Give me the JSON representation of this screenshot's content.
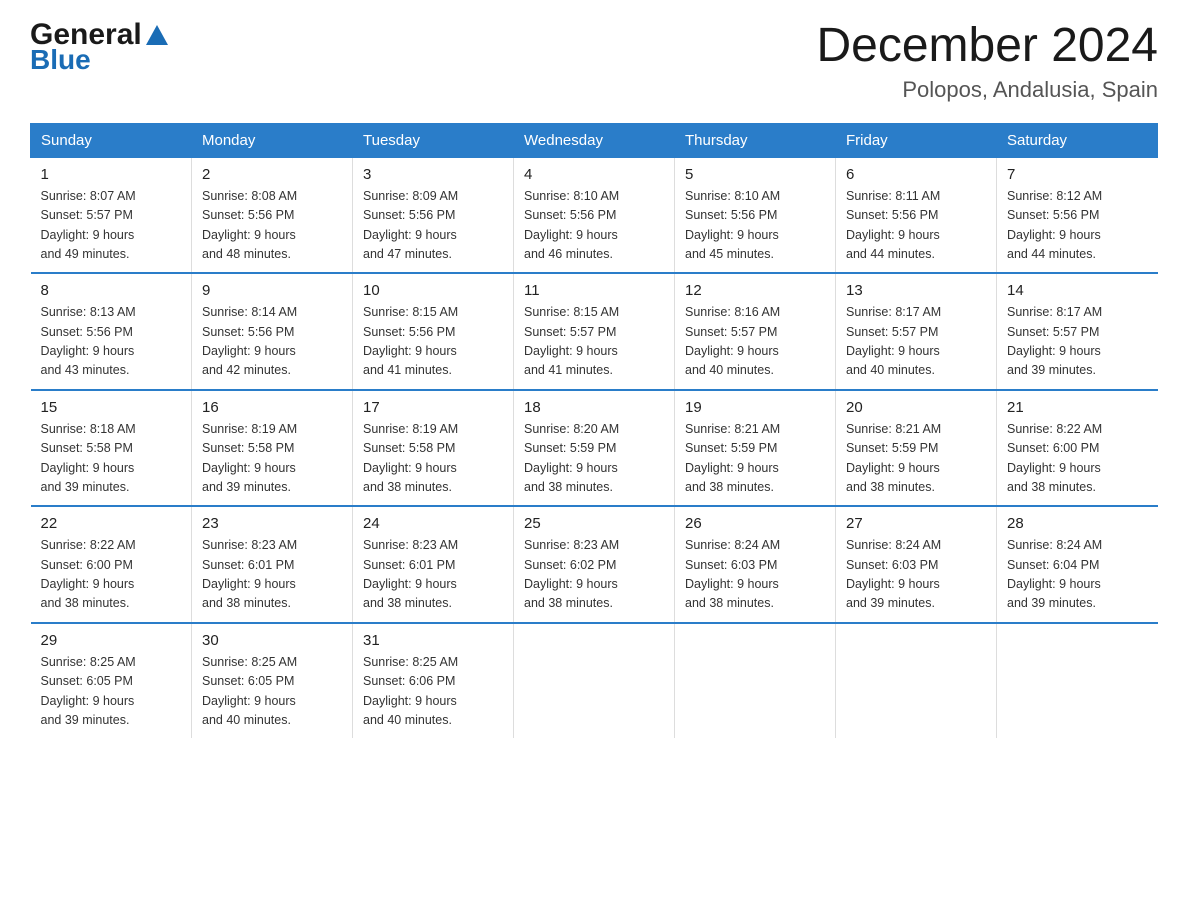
{
  "logo": {
    "text_general": "General",
    "triangle_symbol": "▲",
    "text_blue": "Blue"
  },
  "header": {
    "title": "December 2024",
    "subtitle": "Polopos, Andalusia, Spain"
  },
  "days_of_week": [
    "Sunday",
    "Monday",
    "Tuesday",
    "Wednesday",
    "Thursday",
    "Friday",
    "Saturday"
  ],
  "weeks": [
    [
      {
        "day": "1",
        "sunrise": "8:07 AM",
        "sunset": "5:57 PM",
        "daylight": "9 hours and 49 minutes."
      },
      {
        "day": "2",
        "sunrise": "8:08 AM",
        "sunset": "5:56 PM",
        "daylight": "9 hours and 48 minutes."
      },
      {
        "day": "3",
        "sunrise": "8:09 AM",
        "sunset": "5:56 PM",
        "daylight": "9 hours and 47 minutes."
      },
      {
        "day": "4",
        "sunrise": "8:10 AM",
        "sunset": "5:56 PM",
        "daylight": "9 hours and 46 minutes."
      },
      {
        "day": "5",
        "sunrise": "8:10 AM",
        "sunset": "5:56 PM",
        "daylight": "9 hours and 45 minutes."
      },
      {
        "day": "6",
        "sunrise": "8:11 AM",
        "sunset": "5:56 PM",
        "daylight": "9 hours and 44 minutes."
      },
      {
        "day": "7",
        "sunrise": "8:12 AM",
        "sunset": "5:56 PM",
        "daylight": "9 hours and 44 minutes."
      }
    ],
    [
      {
        "day": "8",
        "sunrise": "8:13 AM",
        "sunset": "5:56 PM",
        "daylight": "9 hours and 43 minutes."
      },
      {
        "day": "9",
        "sunrise": "8:14 AM",
        "sunset": "5:56 PM",
        "daylight": "9 hours and 42 minutes."
      },
      {
        "day": "10",
        "sunrise": "8:15 AM",
        "sunset": "5:56 PM",
        "daylight": "9 hours and 41 minutes."
      },
      {
        "day": "11",
        "sunrise": "8:15 AM",
        "sunset": "5:57 PM",
        "daylight": "9 hours and 41 minutes."
      },
      {
        "day": "12",
        "sunrise": "8:16 AM",
        "sunset": "5:57 PM",
        "daylight": "9 hours and 40 minutes."
      },
      {
        "day": "13",
        "sunrise": "8:17 AM",
        "sunset": "5:57 PM",
        "daylight": "9 hours and 40 minutes."
      },
      {
        "day": "14",
        "sunrise": "8:17 AM",
        "sunset": "5:57 PM",
        "daylight": "9 hours and 39 minutes."
      }
    ],
    [
      {
        "day": "15",
        "sunrise": "8:18 AM",
        "sunset": "5:58 PM",
        "daylight": "9 hours and 39 minutes."
      },
      {
        "day": "16",
        "sunrise": "8:19 AM",
        "sunset": "5:58 PM",
        "daylight": "9 hours and 39 minutes."
      },
      {
        "day": "17",
        "sunrise": "8:19 AM",
        "sunset": "5:58 PM",
        "daylight": "9 hours and 38 minutes."
      },
      {
        "day": "18",
        "sunrise": "8:20 AM",
        "sunset": "5:59 PM",
        "daylight": "9 hours and 38 minutes."
      },
      {
        "day": "19",
        "sunrise": "8:21 AM",
        "sunset": "5:59 PM",
        "daylight": "9 hours and 38 minutes."
      },
      {
        "day": "20",
        "sunrise": "8:21 AM",
        "sunset": "5:59 PM",
        "daylight": "9 hours and 38 minutes."
      },
      {
        "day": "21",
        "sunrise": "8:22 AM",
        "sunset": "6:00 PM",
        "daylight": "9 hours and 38 minutes."
      }
    ],
    [
      {
        "day": "22",
        "sunrise": "8:22 AM",
        "sunset": "6:00 PM",
        "daylight": "9 hours and 38 minutes."
      },
      {
        "day": "23",
        "sunrise": "8:23 AM",
        "sunset": "6:01 PM",
        "daylight": "9 hours and 38 minutes."
      },
      {
        "day": "24",
        "sunrise": "8:23 AM",
        "sunset": "6:01 PM",
        "daylight": "9 hours and 38 minutes."
      },
      {
        "day": "25",
        "sunrise": "8:23 AM",
        "sunset": "6:02 PM",
        "daylight": "9 hours and 38 minutes."
      },
      {
        "day": "26",
        "sunrise": "8:24 AM",
        "sunset": "6:03 PM",
        "daylight": "9 hours and 38 minutes."
      },
      {
        "day": "27",
        "sunrise": "8:24 AM",
        "sunset": "6:03 PM",
        "daylight": "9 hours and 39 minutes."
      },
      {
        "day": "28",
        "sunrise": "8:24 AM",
        "sunset": "6:04 PM",
        "daylight": "9 hours and 39 minutes."
      }
    ],
    [
      {
        "day": "29",
        "sunrise": "8:25 AM",
        "sunset": "6:05 PM",
        "daylight": "9 hours and 39 minutes."
      },
      {
        "day": "30",
        "sunrise": "8:25 AM",
        "sunset": "6:05 PM",
        "daylight": "9 hours and 40 minutes."
      },
      {
        "day": "31",
        "sunrise": "8:25 AM",
        "sunset": "6:06 PM",
        "daylight": "9 hours and 40 minutes."
      },
      null,
      null,
      null,
      null
    ]
  ],
  "labels": {
    "sunrise": "Sunrise:",
    "sunset": "Sunset:",
    "daylight": "Daylight:"
  }
}
